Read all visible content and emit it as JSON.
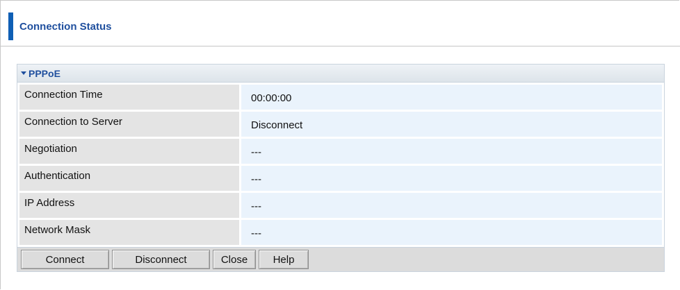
{
  "header": {
    "title": "Connection Status"
  },
  "panel": {
    "title": "PPPoE",
    "rows": [
      {
        "label": "Connection Time",
        "value": "00:00:00"
      },
      {
        "label": "Connection to Server",
        "value": "Disconnect"
      },
      {
        "label": "Negotiation",
        "value": "---"
      },
      {
        "label": "Authentication",
        "value": "---"
      },
      {
        "label": "IP Address",
        "value": "---"
      },
      {
        "label": "Network Mask",
        "value": "---"
      }
    ]
  },
  "buttons": {
    "connect": "Connect",
    "disconnect": "Disconnect",
    "close": "Close",
    "help": "Help"
  },
  "colors": {
    "accent": "#0f5fb5",
    "title_text": "#1f4f9e",
    "label_bg": "#e4e4e4",
    "value_bg": "#eaf3fc",
    "button_bar_bg": "#dcdcdc"
  },
  "icons": {
    "panel_caret": "caret-down-icon"
  }
}
